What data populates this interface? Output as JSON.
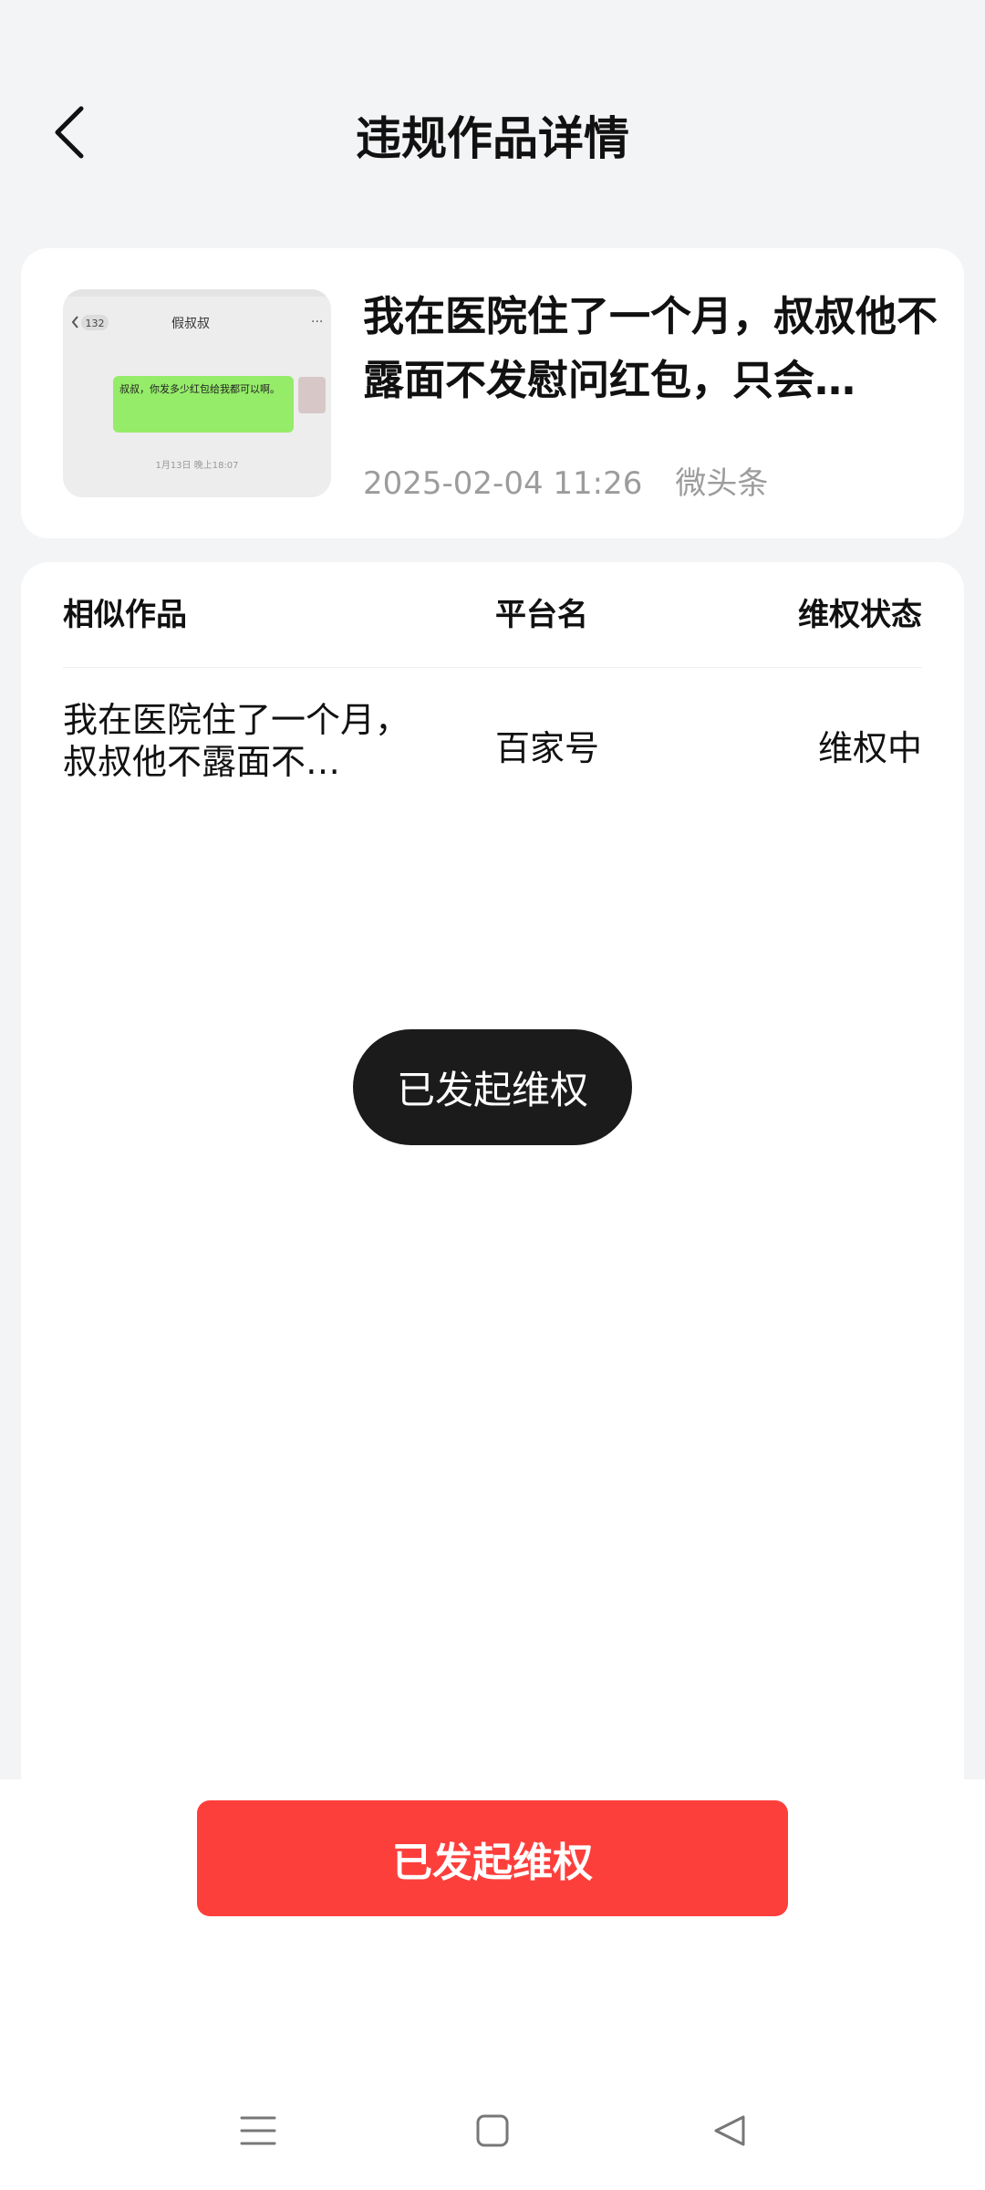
{
  "header": {
    "title": "违规作品详情",
    "back_icon": "chevron-left-icon"
  },
  "work": {
    "title": "我在医院住了一个月，叔叔他不露面不发慰问红包，只会…",
    "datetime": "2025-02-04 11:26",
    "platform": "微头条",
    "thumbnail": {
      "chat_name": "假叔叔",
      "unread_count": "132",
      "message": "叔叔，你发多少红包给我都可以啊。",
      "timestamp": "1月13日 晚上18:07"
    }
  },
  "similar": {
    "headers": {
      "work": "相似作品",
      "platform": "平台名",
      "status": "维权状态"
    },
    "rows": [
      {
        "title": "我在医院住了一个月，叔叔他不露面不…",
        "platform": "百家号",
        "status": "维权中"
      }
    ]
  },
  "toast": {
    "text": "已发起维权"
  },
  "action_button": {
    "label": "已发起维权",
    "color": "#fd3f3c"
  },
  "system_nav": {
    "menu_icon": "menu-icon",
    "home_icon": "home-square-icon",
    "back_icon": "back-triangle-icon"
  }
}
